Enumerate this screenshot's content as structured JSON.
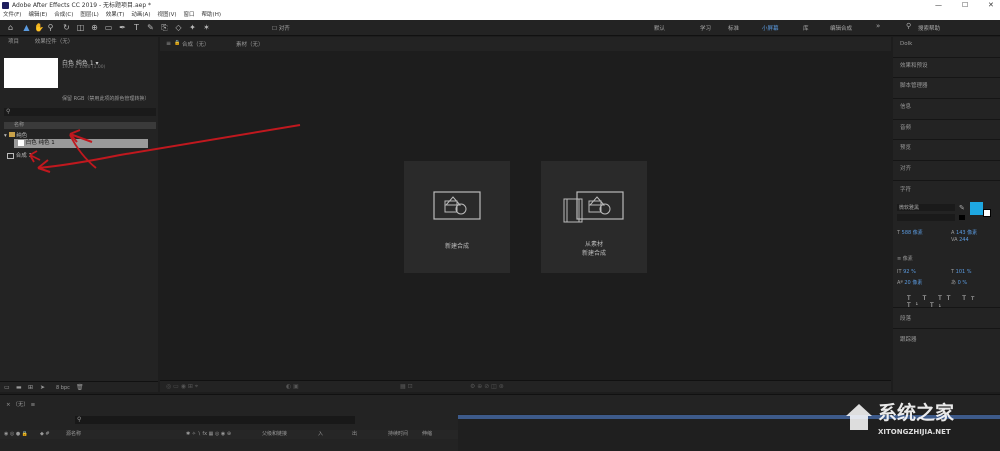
{
  "window": {
    "title": "Adobe After Effects CC 2019 - 无标题项目.aep *"
  },
  "menu": [
    "文件(F)",
    "编辑(E)",
    "合成(C)",
    "图层(L)",
    "效果(T)",
    "动画(A)",
    "视图(V)",
    "窗口",
    "帮助(H)"
  ],
  "toolbar": {
    "align_label": "对齐",
    "search_placeholder": "搜索帮助"
  },
  "workspaces": [
    "默认",
    "学习",
    "标准",
    "小屏幕",
    "库",
    "编辑合成"
  ],
  "project_panel": {
    "tab_project": "项目",
    "tab_effects": "效果控件（无）",
    "item_name": "白色 纯色 1",
    "item_meta": "1920 x 1080 (1.00)",
    "color_note": "8 bpc",
    "info_text": "保留 RGB（禁用此项的颜色管理转换）",
    "col_name": "名称",
    "folder_name": "纯色",
    "solid_item": "白色 纯色 1",
    "comp_item": "合成 1",
    "bpc": "8 bpc"
  },
  "comp_panel": {
    "tab_comp": "合成（无）",
    "tab_footage": "素材（无）",
    "new_comp": "新建合成",
    "from_footage_1": "从素材",
    "from_footage_2": "新建合成"
  },
  "right_panel": {
    "items": [
      "Dolk",
      "效果和预设",
      "脚本管理器",
      "信息",
      "音频",
      "预览",
      "对齐",
      "字符",
      "段落",
      "跟踪器"
    ],
    "char_font": "微软雅黑",
    "size_val": "588 像素",
    "leading_val": "143 像素",
    "tracking_val": "244",
    "indent_val": "像素",
    "scale_v": "92 %",
    "scale_h": "101 %",
    "baseline": "20 像素",
    "tsume": "0 %",
    "accent_color": "#1ea7e1"
  },
  "timeline": {
    "tab": "（无）",
    "cols": [
      "源名称",
      "父级和链接",
      "入",
      "出",
      "持续时间",
      "伸缩"
    ]
  },
  "watermark": {
    "brand": "系统之家",
    "url": "XITONGZHIJIA.NET"
  }
}
